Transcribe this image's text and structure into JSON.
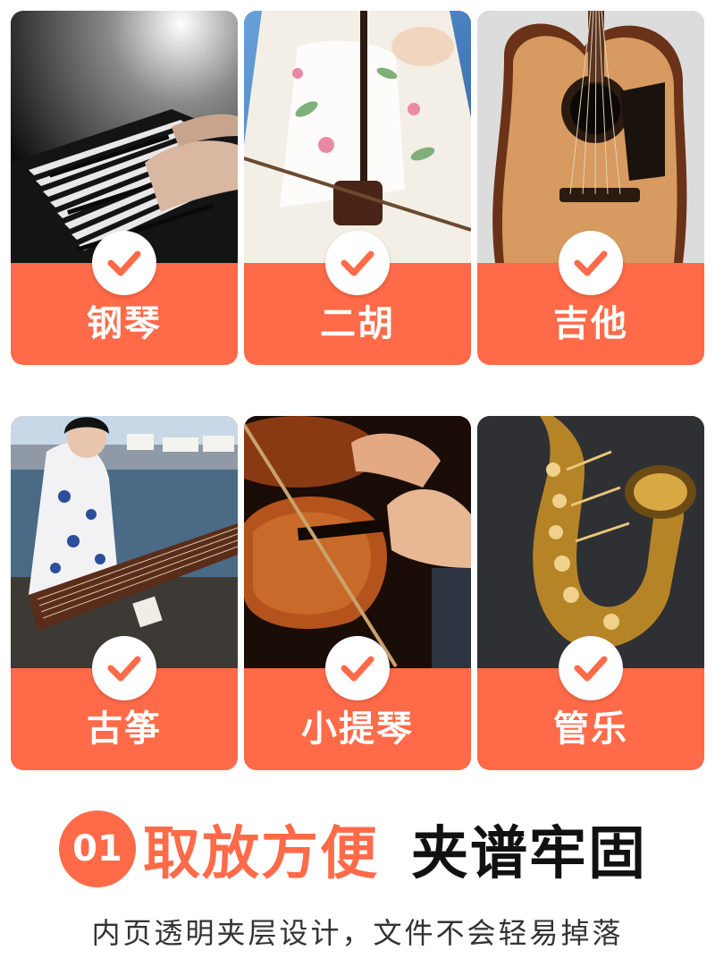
{
  "instruments": [
    {
      "label": "钢琴",
      "image": "piano-photo"
    },
    {
      "label": "二胡",
      "image": "erhu-photo"
    },
    {
      "label": "吉他",
      "image": "guitar-photo"
    },
    {
      "label": "古筝",
      "image": "guzheng-photo"
    },
    {
      "label": "小提琴",
      "image": "violin-photo"
    },
    {
      "label": "管乐",
      "image": "saxophone-photo"
    }
  ],
  "feature": {
    "number": "01",
    "accent": "取放方便",
    "main": "夹谱牢固",
    "subtitle": "内页透明夹层设计，文件不会轻易掉落"
  },
  "colors": {
    "accent": "#ff6a48",
    "text": "#111111"
  },
  "icons": {
    "badge": "check-icon"
  }
}
